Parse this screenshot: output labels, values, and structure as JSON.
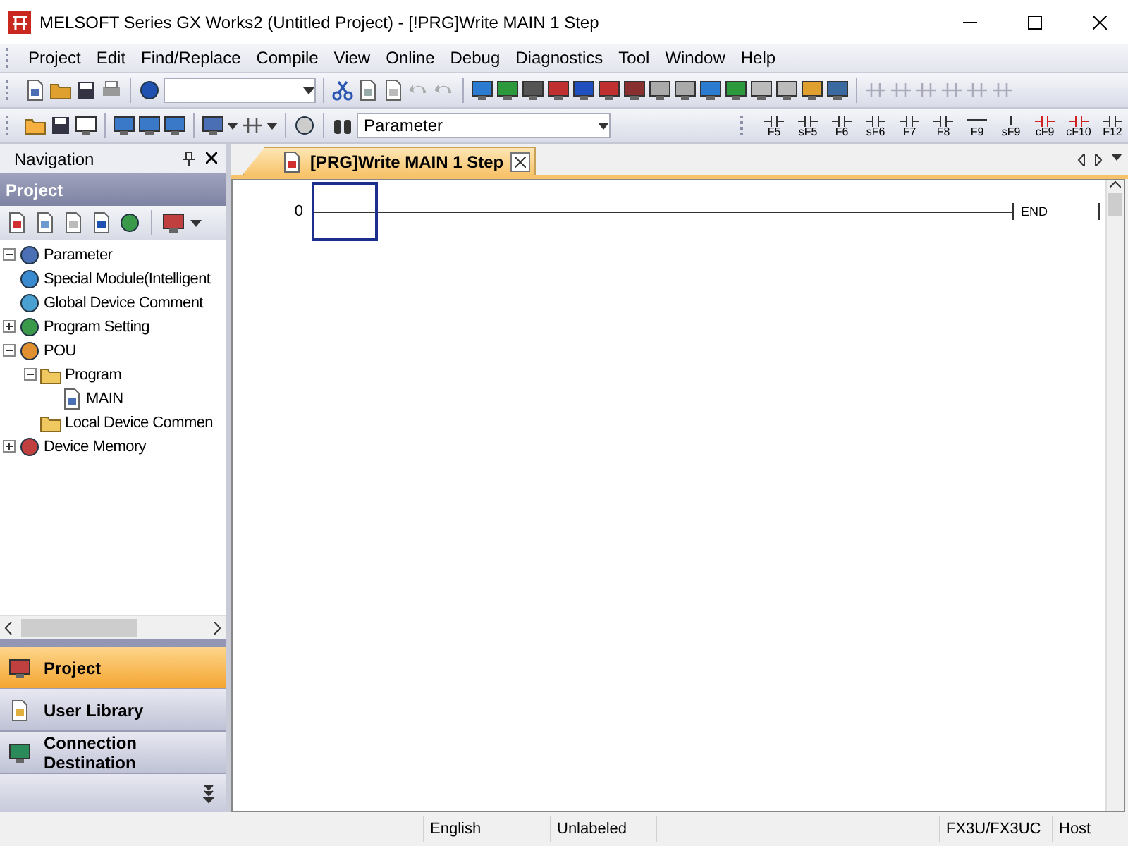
{
  "window": {
    "title": "MELSOFT Series GX Works2 (Untitled Project) - [!PRG]Write MAIN 1 Step"
  },
  "menu": [
    "Project",
    "Edit",
    "Find/Replace",
    "Compile",
    "View",
    "Online",
    "Debug",
    "Diagnostics",
    "Tool",
    "Window",
    "Help"
  ],
  "toolbar": {
    "data_type_combo": "Parameter",
    "ladder_keys": [
      "F5",
      "sF5",
      "F6",
      "sF6",
      "F7",
      "F8",
      "F9",
      "sF9",
      "cF9",
      "cF10",
      "F12"
    ]
  },
  "navigation": {
    "title": "Navigation",
    "section": "Project",
    "tree": [
      {
        "label": "Parameter",
        "expanded": true
      },
      {
        "label": "Special Module(Intelligent"
      },
      {
        "label": "Global Device Comment"
      },
      {
        "label": "Program Setting",
        "expanded": false
      },
      {
        "label": "POU",
        "expanded": true,
        "children": [
          {
            "label": "Program",
            "expanded": true,
            "children": [
              {
                "label": "MAIN"
              }
            ]
          },
          {
            "label": "Local Device Commen"
          }
        ]
      },
      {
        "label": "Device Memory",
        "expanded": false
      }
    ],
    "nav_buttons": [
      {
        "label": "Project",
        "selected": true
      },
      {
        "label": "User Library",
        "selected": false
      },
      {
        "label": "Connection Destination",
        "selected": false
      }
    ]
  },
  "editor": {
    "tab": "[PRG]Write MAIN 1 Step",
    "rungs": [
      {
        "step": "0",
        "end": "END"
      }
    ]
  },
  "status_bar": [
    "English",
    "Unlabeled",
    "FX3U/FX3UC",
    "Host"
  ]
}
